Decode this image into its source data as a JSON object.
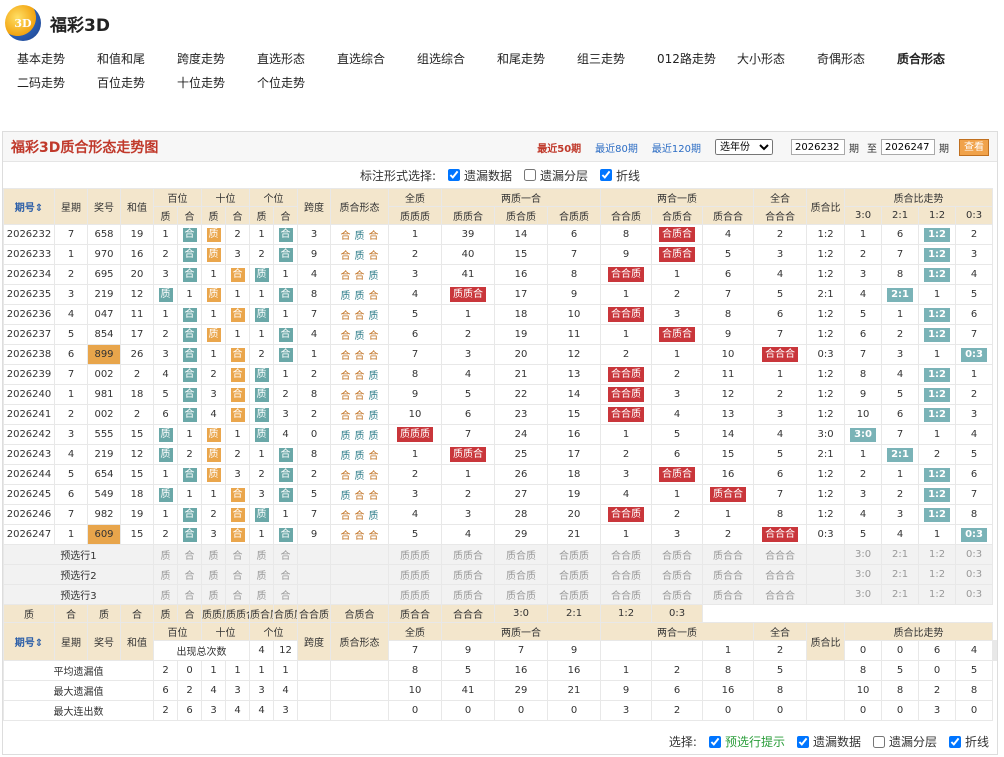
{
  "app": {
    "title": "福彩3D"
  },
  "nav": {
    "row1": [
      "基本走势",
      "和值和尾",
      "跨度走势",
      "直选形态",
      "直选综合",
      "组选综合",
      "和尾走势",
      "组三走势",
      "012路走势",
      "大小形态",
      "奇偶形态",
      "质合形态"
    ],
    "row2": [
      "二码走势",
      "百位走势",
      "十位走势",
      "个位走势"
    ],
    "active": "质合形态"
  },
  "panel": {
    "title": "福彩3D质合形态走势图",
    "recent": [
      "最近50期",
      "最近80期",
      "最近120期"
    ],
    "year_select": "选年份",
    "from_label": "期",
    "to_label": "至",
    "from_value": "2026232",
    "to_value": "2026247",
    "period_suffix": "期",
    "go_button": "查看"
  },
  "options": {
    "label": "标注形式选择:",
    "items": [
      {
        "label": "遗漏数据",
        "checked": true
      },
      {
        "label": "遗漏分层",
        "checked": false
      },
      {
        "label": "折线",
        "checked": true
      }
    ]
  },
  "headers": {
    "issue": "期号",
    "week": "星期",
    "prize": "奖号",
    "sum": "和值",
    "bai": "百位",
    "shi": "十位",
    "ge": "个位",
    "zhi": "质",
    "he": "合",
    "span": "跨度",
    "shape": "质合形态",
    "g_quanzhi": "全质",
    "g_liangzhi": "两质一合",
    "g_lianghe": "两合一质",
    "g_quanhe": "全合",
    "ratio": "质合比",
    "ratio_trend": "质合比走势",
    "cols": [
      "质质质",
      "质质合",
      "质合质",
      "合质质",
      "合合质",
      "合质合",
      "质合合",
      "合合合"
    ],
    "ratios": [
      "3:0",
      "2:1",
      "1:2",
      "0:3"
    ]
  },
  "rows": [
    {
      "issue": "2026232",
      "week": "7",
      "prize": "658",
      "sum": "19",
      "pos": [
        [
          "1",
          "合"
        ],
        [
          "质",
          "2"
        ],
        [
          "1",
          "合"
        ]
      ],
      "span": "3",
      "shape": [
        "合",
        "质",
        "合"
      ],
      "g": [
        "1",
        "39",
        "14",
        "6",
        "8",
        "合质合",
        "4",
        "2"
      ],
      "ratio": "1:2",
      "rt": [
        "1",
        "6",
        "1:2",
        "2"
      ]
    },
    {
      "issue": "2026233",
      "week": "1",
      "prize": "970",
      "sum": "16",
      "pos": [
        [
          "2",
          "合"
        ],
        [
          "质",
          "3"
        ],
        [
          "2",
          "合"
        ]
      ],
      "span": "9",
      "shape": [
        "合",
        "质",
        "合"
      ],
      "g": [
        "2",
        "40",
        "15",
        "7",
        "9",
        "合质合",
        "5",
        "3"
      ],
      "ratio": "1:2",
      "rt": [
        "2",
        "7",
        "1:2",
        "3"
      ]
    },
    {
      "issue": "2026234",
      "week": "2",
      "prize": "695",
      "sum": "20",
      "pos": [
        [
          "3",
          "合"
        ],
        [
          "1",
          "合"
        ],
        [
          "质",
          "1"
        ]
      ],
      "span": "4",
      "shape": [
        "合",
        "合",
        "质"
      ],
      "g": [
        "3",
        "41",
        "16",
        "8",
        "合合质",
        "1",
        "6",
        "4"
      ],
      "ratio": "1:2",
      "rt": [
        "3",
        "8",
        "1:2",
        "4"
      ]
    },
    {
      "issue": "2026235",
      "week": "3",
      "prize": "219",
      "sum": "12",
      "pos": [
        [
          "质",
          "1"
        ],
        [
          "质",
          "1"
        ],
        [
          "1",
          "合"
        ]
      ],
      "span": "8",
      "shape": [
        "质",
        "质",
        "合"
      ],
      "g": [
        "4",
        "质质合",
        "17",
        "9",
        "1",
        "2",
        "7",
        "5"
      ],
      "ratio": "2:1",
      "rt": [
        "4",
        "2:1",
        "1",
        "5"
      ]
    },
    {
      "issue": "2026236",
      "week": "4",
      "prize": "047",
      "sum": "11",
      "pos": [
        [
          "1",
          "合"
        ],
        [
          "1",
          "合"
        ],
        [
          "质",
          "1"
        ]
      ],
      "span": "7",
      "shape": [
        "合",
        "合",
        "质"
      ],
      "g": [
        "5",
        "1",
        "18",
        "10",
        "合合质",
        "3",
        "8",
        "6"
      ],
      "ratio": "1:2",
      "rt": [
        "5",
        "1",
        "1:2",
        "6"
      ]
    },
    {
      "issue": "2026237",
      "week": "5",
      "prize": "854",
      "sum": "17",
      "pos": [
        [
          "2",
          "合"
        ],
        [
          "质",
          "1"
        ],
        [
          "1",
          "合"
        ]
      ],
      "span": "4",
      "shape": [
        "合",
        "质",
        "合"
      ],
      "g": [
        "6",
        "2",
        "19",
        "11",
        "1",
        "合质合",
        "9",
        "7"
      ],
      "ratio": "1:2",
      "rt": [
        "6",
        "2",
        "1:2",
        "7"
      ]
    },
    {
      "issue": "2026238",
      "week": "6",
      "prize": "899",
      "sum": "26",
      "pos": [
        [
          "3",
          "合"
        ],
        [
          "1",
          "合"
        ],
        [
          "2",
          "合"
        ]
      ],
      "span": "1",
      "shape": [
        "合",
        "合",
        "合"
      ],
      "g": [
        "7",
        "3",
        "20",
        "12",
        "2",
        "1",
        "10",
        "合合合"
      ],
      "ratio": "0:3",
      "rt": [
        "7",
        "3",
        "1",
        "0:3"
      ]
    },
    {
      "issue": "2026239",
      "week": "7",
      "prize": "002",
      "sum": "2",
      "pos": [
        [
          "4",
          "合"
        ],
        [
          "2",
          "合"
        ],
        [
          "质",
          "1"
        ]
      ],
      "span": "2",
      "shape": [
        "合",
        "合",
        "质"
      ],
      "g": [
        "8",
        "4",
        "21",
        "13",
        "合合质",
        "2",
        "11",
        "1"
      ],
      "ratio": "1:2",
      "rt": [
        "8",
        "4",
        "1:2",
        "1"
      ]
    },
    {
      "issue": "2026240",
      "week": "1",
      "prize": "981",
      "sum": "18",
      "pos": [
        [
          "5",
          "合"
        ],
        [
          "3",
          "合"
        ],
        [
          "质",
          "2"
        ]
      ],
      "span": "8",
      "shape": [
        "合",
        "合",
        "质"
      ],
      "g": [
        "9",
        "5",
        "22",
        "14",
        "合合质",
        "3",
        "12",
        "2"
      ],
      "ratio": "1:2",
      "rt": [
        "9",
        "5",
        "1:2",
        "2"
      ]
    },
    {
      "issue": "2026241",
      "week": "2",
      "prize": "002",
      "sum": "2",
      "pos": [
        [
          "6",
          "合"
        ],
        [
          "4",
          "合"
        ],
        [
          "质",
          "3"
        ]
      ],
      "span": "2",
      "shape": [
        "合",
        "合",
        "质"
      ],
      "g": [
        "10",
        "6",
        "23",
        "15",
        "合合质",
        "4",
        "13",
        "3"
      ],
      "ratio": "1:2",
      "rt": [
        "10",
        "6",
        "1:2",
        "3"
      ]
    },
    {
      "issue": "2026242",
      "week": "3",
      "prize": "555",
      "sum": "15",
      "pos": [
        [
          "质",
          "1"
        ],
        [
          "质",
          "1"
        ],
        [
          "质",
          "4"
        ]
      ],
      "span": "0",
      "shape": [
        "质",
        "质",
        "质"
      ],
      "g": [
        "质质质",
        "7",
        "24",
        "16",
        "1",
        "5",
        "14",
        "4"
      ],
      "ratio": "3:0",
      "rt": [
        "3:0",
        "7",
        "1",
        "4"
      ]
    },
    {
      "issue": "2026243",
      "week": "4",
      "prize": "219",
      "sum": "12",
      "pos": [
        [
          "质",
          "2"
        ],
        [
          "质",
          "2"
        ],
        [
          "1",
          "合"
        ]
      ],
      "span": "8",
      "shape": [
        "质",
        "质",
        "合"
      ],
      "g": [
        "1",
        "质质合",
        "25",
        "17",
        "2",
        "6",
        "15",
        "5"
      ],
      "ratio": "2:1",
      "rt": [
        "1",
        "2:1",
        "2",
        "5"
      ]
    },
    {
      "issue": "2026244",
      "week": "5",
      "prize": "654",
      "sum": "15",
      "pos": [
        [
          "1",
          "合"
        ],
        [
          "质",
          "3"
        ],
        [
          "2",
          "合"
        ]
      ],
      "span": "2",
      "shape": [
        "合",
        "质",
        "合"
      ],
      "g": [
        "2",
        "1",
        "26",
        "18",
        "3",
        "合质合",
        "16",
        "6"
      ],
      "ratio": "1:2",
      "rt": [
        "2",
        "1",
        "1:2",
        "6"
      ]
    },
    {
      "issue": "2026245",
      "week": "6",
      "prize": "549",
      "sum": "18",
      "pos": [
        [
          "质",
          "1"
        ],
        [
          "1",
          "合"
        ],
        [
          "3",
          "合"
        ]
      ],
      "span": "5",
      "shape": [
        "质",
        "合",
        "合"
      ],
      "g": [
        "3",
        "2",
        "27",
        "19",
        "4",
        "1",
        "质合合",
        "7"
      ],
      "ratio": "1:2",
      "rt": [
        "3",
        "2",
        "1:2",
        "7"
      ]
    },
    {
      "issue": "2026246",
      "week": "7",
      "prize": "982",
      "sum": "19",
      "pos": [
        [
          "1",
          "合"
        ],
        [
          "2",
          "合"
        ],
        [
          "质",
          "1"
        ]
      ],
      "span": "7",
      "shape": [
        "合",
        "合",
        "质"
      ],
      "g": [
        "4",
        "3",
        "28",
        "20",
        "合合质",
        "2",
        "1",
        "8"
      ],
      "ratio": "1:2",
      "rt": [
        "4",
        "3",
        "1:2",
        "8"
      ]
    },
    {
      "issue": "2026247",
      "week": "1",
      "prize": "609",
      "sum": "15",
      "pos": [
        [
          "2",
          "合"
        ],
        [
          "3",
          "合"
        ],
        [
          "1",
          "合"
        ]
      ],
      "span": "9",
      "shape": [
        "合",
        "合",
        "合"
      ],
      "g": [
        "5",
        "4",
        "29",
        "21",
        "1",
        "3",
        "2",
        "合合合"
      ],
      "ratio": "0:3",
      "rt": [
        "5",
        "4",
        "1",
        "0:3"
      ]
    }
  ],
  "preselect": {
    "labels": [
      "预选行1",
      "预选行2",
      "预选行3"
    ]
  },
  "stats": [
    {
      "label": "出现总次数",
      "pos": [
        "4",
        "12",
        "7",
        "9",
        "7",
        "9"
      ],
      "g": [
        "1",
        "2",
        "0",
        "0",
        "6",
        "4",
        "1",
        "2"
      ],
      "rt": [
        "1",
        "2",
        "11",
        "2"
      ]
    },
    {
      "label": "平均遗漏值",
      "pos": [
        "2",
        "0",
        "1",
        "1",
        "1",
        "1"
      ],
      "g": [
        "8",
        "5",
        "16",
        "16",
        "1",
        "2",
        "8",
        "5"
      ],
      "rt": [
        "8",
        "5",
        "0",
        "5"
      ]
    },
    {
      "label": "最大遗漏值",
      "pos": [
        "6",
        "2",
        "4",
        "3",
        "3",
        "4"
      ],
      "g": [
        "10",
        "41",
        "29",
        "21",
        "9",
        "6",
        "16",
        "8"
      ],
      "rt": [
        "10",
        "8",
        "2",
        "8"
      ]
    },
    {
      "label": "最大连出数",
      "pos": [
        "2",
        "6",
        "3",
        "4",
        "4",
        "3"
      ],
      "g": [
        "0",
        "0",
        "0",
        "0",
        "3",
        "2",
        "0",
        "0"
      ],
      "rt": [
        "0",
        "0",
        "3",
        "0"
      ]
    }
  ],
  "footer": {
    "label": "选择:",
    "items": [
      {
        "label": "预选行提示",
        "checked": true
      },
      {
        "label": "遗漏数据",
        "checked": true
      },
      {
        "label": "遗漏分层",
        "checked": false
      },
      {
        "label": "折线",
        "checked": true
      }
    ]
  },
  "colors": {
    "accent": "#c9363b",
    "teal": "#6aa8a8",
    "orange": "#eaa64c",
    "header_bg": "#f3e6cc"
  }
}
